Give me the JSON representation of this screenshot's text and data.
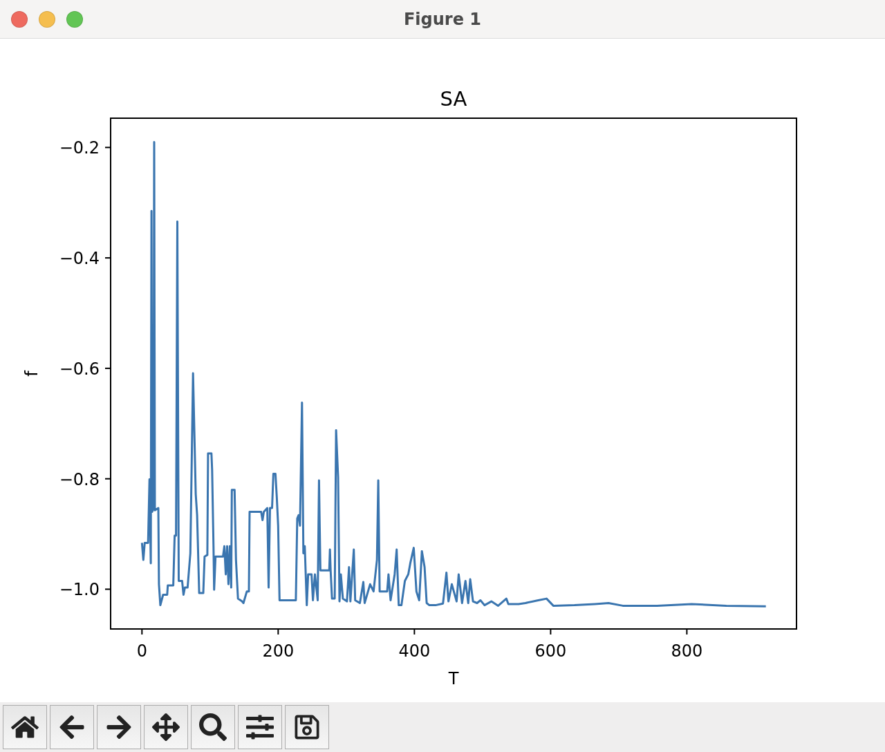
{
  "window": {
    "title": "Figure 1"
  },
  "figure": {
    "chart_data": {
      "type": "line",
      "title": "SA",
      "xlabel": "T",
      "ylabel": "f",
      "x": [
        0,
        2,
        4,
        9,
        11,
        13,
        14,
        15,
        17,
        18,
        19,
        24,
        25,
        27,
        31,
        37,
        38,
        46,
        48,
        50,
        52,
        54,
        59,
        61,
        63,
        67,
        71,
        75,
        79,
        81,
        84,
        90,
        92,
        96,
        97,
        102,
        103,
        105,
        106,
        108,
        119,
        121,
        123,
        125,
        127,
        129,
        131,
        132,
        136,
        138,
        141,
        147,
        149,
        154,
        157,
        158,
        175,
        177,
        179,
        184,
        186,
        188,
        191,
        193,
        196,
        198,
        200,
        202,
        226,
        228,
        230,
        232,
        235,
        237,
        239,
        242,
        244,
        249,
        251,
        254,
        258,
        260,
        262,
        275,
        276,
        277,
        279,
        283,
        285,
        288,
        290,
        292,
        295,
        301,
        304,
        306,
        311,
        313,
        320,
        325,
        327,
        335,
        340,
        345,
        347,
        349,
        360,
        362,
        365,
        371,
        374,
        377,
        381,
        386,
        391,
        394,
        399,
        403,
        407,
        411,
        415,
        418,
        422,
        431,
        442,
        447,
        450,
        455,
        462,
        465,
        470,
        475,
        479,
        482,
        486,
        492,
        497,
        503,
        513,
        523,
        535,
        538,
        553,
        563,
        582,
        594,
        604,
        635,
        665,
        685,
        706,
        756,
        807,
        858,
        916
      ],
      "values": [
        -0.916,
        -0.947,
        -0.916,
        -0.916,
        -0.801,
        -0.953,
        -0.315,
        -0.86,
        -0.853,
        -0.19,
        -0.857,
        -0.853,
        -0.991,
        -1.029,
        -1.01,
        -1.01,
        -0.993,
        -0.993,
        -0.903,
        -0.903,
        -0.334,
        -0.985,
        -0.985,
        -1.01,
        -0.997,
        -0.997,
        -0.935,
        -0.609,
        -0.828,
        -0.866,
        -1.007,
        -1.007,
        -0.941,
        -0.938,
        -0.754,
        -0.754,
        -0.784,
        -0.922,
        -1.001,
        -0.941,
        -0.941,
        -0.922,
        -0.973,
        -0.922,
        -0.991,
        -0.922,
        -0.997,
        -0.82,
        -0.82,
        -0.947,
        -1.017,
        -1.022,
        -1.025,
        -1.004,
        -1.004,
        -0.86,
        -0.86,
        -0.875,
        -0.86,
        -0.853,
        -0.997,
        -0.853,
        -0.853,
        -0.791,
        -0.791,
        -0.835,
        -0.885,
        -1.02,
        -1.02,
        -0.872,
        -0.866,
        -0.885,
        -0.662,
        -0.935,
        -0.922,
        -1.029,
        -0.973,
        -0.973,
        -1.02,
        -0.973,
        -1.02,
        -0.803,
        -0.966,
        -0.966,
        -0.928,
        -0.966,
        -1.017,
        -1.017,
        -0.712,
        -0.797,
        -1.022,
        -0.973,
        -1.017,
        -1.022,
        -0.96,
        -1.022,
        -0.928,
        -1.02,
        -1.025,
        -0.987,
        -1.025,
        -0.991,
        -1.004,
        -0.947,
        -0.803,
        -1.004,
        -1.004,
        -0.973,
        -1.02,
        -0.973,
        -0.928,
        -1.029,
        -1.029,
        -0.985,
        -0.973,
        -0.953,
        -0.925,
        -1.004,
        -1.02,
        -0.931,
        -0.96,
        -1.025,
        -1.029,
        -1.029,
        -1.026,
        -0.97,
        -1.022,
        -0.991,
        -1.022,
        -0.973,
        -1.025,
        -0.985,
        -1.025,
        -0.982,
        -1.022,
        -1.025,
        -1.02,
        -1.029,
        -1.022,
        -1.03,
        -1.017,
        -1.027,
        -1.027,
        -1.025,
        -1.02,
        -1.017,
        -1.03,
        -1.029,
        -1.027,
        -1.025,
        -1.03,
        -1.03,
        -1.027,
        -1.03,
        -1.031
      ],
      "xlim": [
        -46,
        961
      ],
      "ylim": [
        -1.072,
        -0.147
      ],
      "xticks": [
        0,
        200,
        400,
        600,
        800
      ],
      "yticks": [
        {
          "value": -0.2,
          "label": "−0.2"
        },
        {
          "value": -0.4,
          "label": "−0.4"
        },
        {
          "value": -0.6,
          "label": "−0.6"
        },
        {
          "value": -0.8,
          "label": "−0.8"
        },
        {
          "value": -1.0,
          "label": "−1.0"
        }
      ]
    }
  },
  "toolbar": [
    {
      "kind": "home"
    },
    {
      "kind": "back"
    },
    {
      "kind": "forward"
    },
    {
      "kind": "pan"
    },
    {
      "kind": "zoom"
    },
    {
      "kind": "configure"
    },
    {
      "kind": "save"
    }
  ]
}
